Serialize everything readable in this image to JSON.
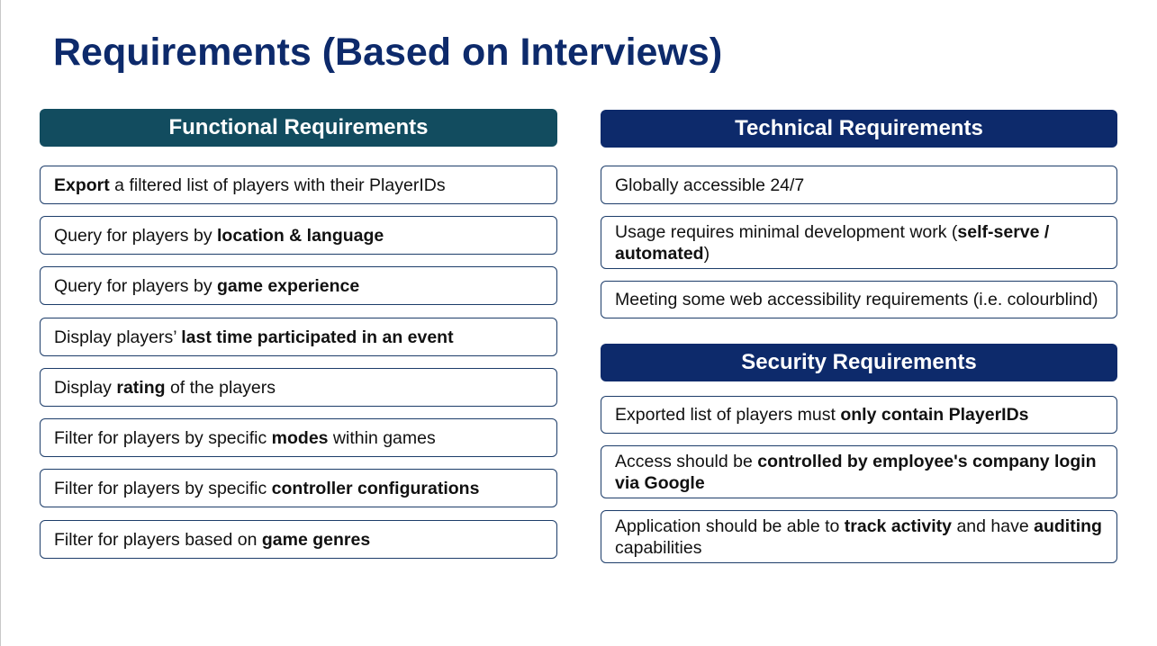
{
  "title": "Requirements (Based on Interviews)",
  "functional": {
    "header": "Functional Requirements",
    "items": [
      {
        "pre": "",
        "bold": "Export",
        "post": " a filtered list of players with their PlayerIDs"
      },
      {
        "pre": "Query for players by ",
        "bold": "location & language",
        "post": ""
      },
      {
        "pre": "Query for players by ",
        "bold": "game experience",
        "post": ""
      },
      {
        "pre": "Display players’ ",
        "bold": "last time participated in an event",
        "post": ""
      },
      {
        "pre": "Display ",
        "bold": "rating",
        "post": " of the players"
      },
      {
        "pre": "Filter for players by specific ",
        "bold": "modes",
        "post": " within games"
      },
      {
        "pre": "Filter for players by specific ",
        "bold": "controller configurations",
        "post": ""
      },
      {
        "pre": "Filter for players based on ",
        "bold": "game genres",
        "post": ""
      }
    ]
  },
  "technical": {
    "header": "Technical Requirements",
    "items": [
      {
        "pre": "Globally accessible 24/7",
        "bold": "",
        "post": ""
      },
      {
        "pre": "Usage requires minimal development work (",
        "bold": "self-serve / automated",
        "post": ")"
      },
      {
        "pre": "Meeting some web accessibility requirements (i.e. colourblind)",
        "bold": "",
        "post": ""
      }
    ]
  },
  "security": {
    "header": "Security Requirements",
    "items": [
      {
        "pre": "Exported list of players must ",
        "bold": "only contain PlayerIDs",
        "post": ""
      },
      {
        "pre": "Access should be ",
        "bold": "controlled by employee's company login via Google",
        "post": ""
      },
      {
        "pre": "Application should be able to ",
        "bold": "track activity",
        "post": " and have ",
        "bold2": "auditing",
        "post2": " capabilities"
      }
    ]
  },
  "colors": {
    "title": "#0d2a6b",
    "functional_header": "#124c5f",
    "technical_header": "#0d2a6b",
    "security_header": "#0d2a6b",
    "box_border": "#1d3d6a"
  }
}
